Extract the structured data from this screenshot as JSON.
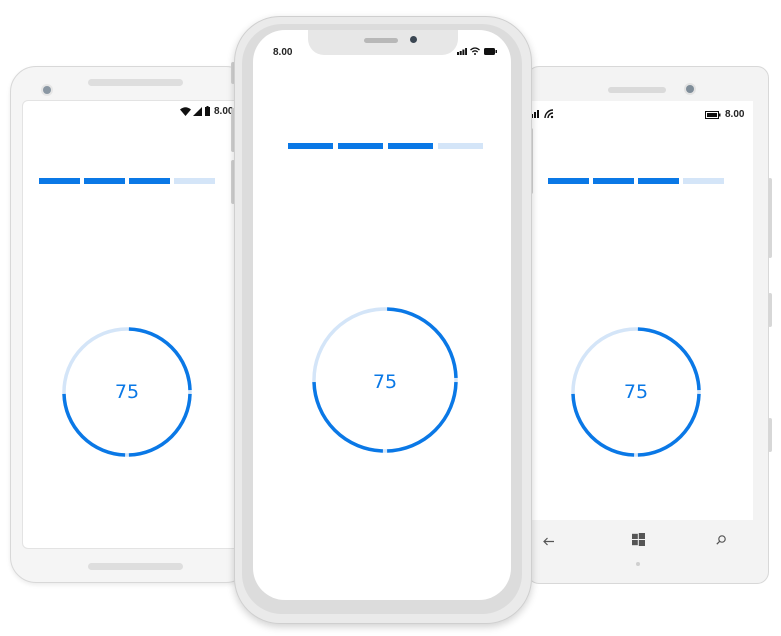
{
  "devices": {
    "android": {
      "status_time": "8.00",
      "progress_value": "75",
      "segments_filled": 3,
      "segments_total": 4
    },
    "iphone": {
      "status_time": "8.00",
      "progress_value": "75",
      "segments_filled": 3,
      "segments_total": 4
    },
    "windows": {
      "status_time": "8.00",
      "progress_value": "75",
      "segments_filled": 3,
      "segments_total": 4,
      "nav_buttons": [
        "back-arrow-icon",
        "windows-start-icon",
        "search-icon"
      ]
    }
  },
  "colors": {
    "progress_filled": "#0a78e6",
    "progress_track": "#d4e5f8"
  },
  "icons": [
    "wifi-icon",
    "signal-icon",
    "battery-icon"
  ]
}
